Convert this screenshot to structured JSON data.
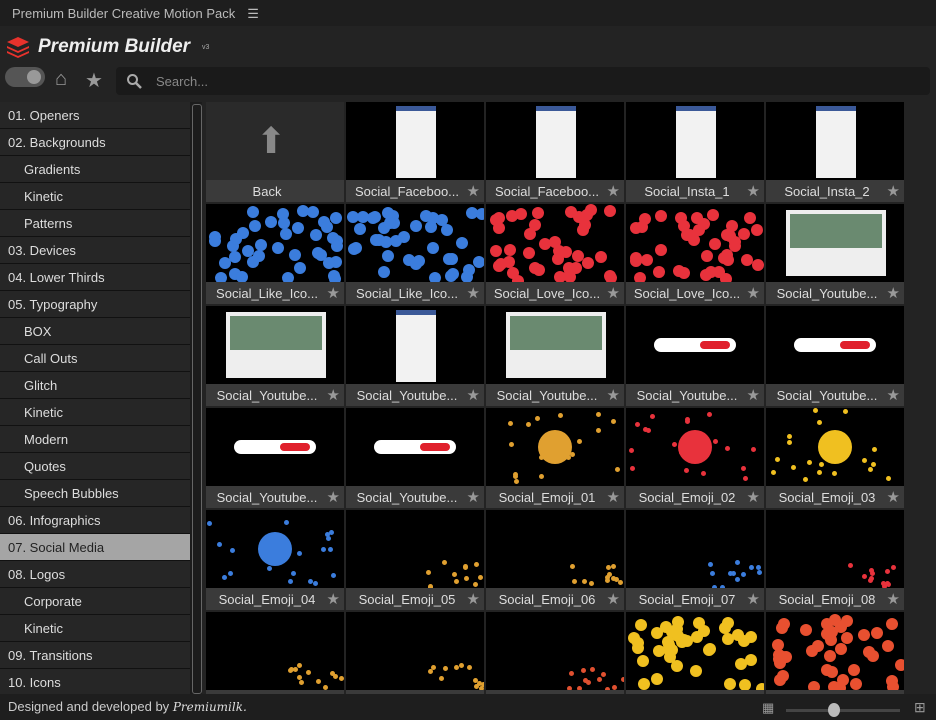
{
  "window": {
    "title": "Premium Builder Creative Motion Pack",
    "menu_icon": "☰"
  },
  "brand": {
    "name": "Premium Builder",
    "version": "v3",
    "color": "#e8322c"
  },
  "search": {
    "placeholder": "Search..."
  },
  "sidebar": [
    {
      "label": "01. Openers",
      "sub": false
    },
    {
      "label": "02. Backgrounds",
      "sub": false
    },
    {
      "label": "Gradients",
      "sub": true
    },
    {
      "label": "Kinetic",
      "sub": true
    },
    {
      "label": "Patterns",
      "sub": true
    },
    {
      "label": "03. Devices",
      "sub": false
    },
    {
      "label": "04. Lower Thirds",
      "sub": false
    },
    {
      "label": "05. Typography",
      "sub": false
    },
    {
      "label": "BOX",
      "sub": true
    },
    {
      "label": "Call Outs",
      "sub": true
    },
    {
      "label": "Glitch",
      "sub": true
    },
    {
      "label": "Kinetic",
      "sub": true
    },
    {
      "label": "Modern",
      "sub": true
    },
    {
      "label": "Quotes",
      "sub": true
    },
    {
      "label": "Speech Bubbles",
      "sub": true
    },
    {
      "label": "06. Infographics",
      "sub": false
    },
    {
      "label": "07. Social Media",
      "sub": false,
      "active": true
    },
    {
      "label": "08. Logos",
      "sub": false
    },
    {
      "label": "Corporate",
      "sub": true
    },
    {
      "label": "Kinetic",
      "sub": true
    },
    {
      "label": "09. Transitions",
      "sub": false
    },
    {
      "label": "10. Icons",
      "sub": false
    }
  ],
  "tiles": [
    {
      "label": "Back",
      "kind": "back"
    },
    {
      "label": "Social_Faceboo...",
      "kind": "phone"
    },
    {
      "label": "Social_Faceboo...",
      "kind": "phone"
    },
    {
      "label": "Social_Insta_1",
      "kind": "phone"
    },
    {
      "label": "Social_Insta_2",
      "kind": "phone"
    },
    {
      "label": "Social_Like_Ico...",
      "kind": "dots",
      "color": "#3b7ddd"
    },
    {
      "label": "Social_Like_Ico...",
      "kind": "dots",
      "color": "#3b7ddd"
    },
    {
      "label": "Social_Love_Ico...",
      "kind": "dots",
      "color": "#e8323c"
    },
    {
      "label": "Social_Love_Ico...",
      "kind": "dots",
      "color": "#e8323c"
    },
    {
      "label": "Social_Youtube...",
      "kind": "screen"
    },
    {
      "label": "Social_Youtube...",
      "kind": "screen"
    },
    {
      "label": "Social_Youtube...",
      "kind": "phone"
    },
    {
      "label": "Social_Youtube...",
      "kind": "screen"
    },
    {
      "label": "Social_Youtube...",
      "kind": "pill"
    },
    {
      "label": "Social_Youtube...",
      "kind": "pill"
    },
    {
      "label": "Social_Youtube...",
      "kind": "pill"
    },
    {
      "label": "Social_Youtube...",
      "kind": "pill"
    },
    {
      "label": "Social_Emoji_01",
      "kind": "sparse",
      "color": "#e0a030"
    },
    {
      "label": "Social_Emoji_02",
      "kind": "sparse",
      "color": "#e8323c"
    },
    {
      "label": "Social_Emoji_03",
      "kind": "sparse",
      "color": "#f0c020"
    },
    {
      "label": "Social_Emoji_04",
      "kind": "sparse",
      "color": "#3b7ddd"
    },
    {
      "label": "Social_Emoji_05",
      "kind": "corner",
      "color": "#e0a030"
    },
    {
      "label": "Social_Emoji_06",
      "kind": "corner",
      "color": "#e0a030"
    },
    {
      "label": "Social_Emoji_07",
      "kind": "corner",
      "color": "#3b7ddd"
    },
    {
      "label": "Social_Emoji_08",
      "kind": "corner",
      "color": "#e8323c"
    },
    {
      "label": "",
      "kind": "corner",
      "color": "#e0a030"
    },
    {
      "label": "",
      "kind": "corner",
      "color": "#e0a030"
    },
    {
      "label": "",
      "kind": "corner",
      "color": "#e05030"
    },
    {
      "label": "",
      "kind": "dots",
      "color": "#f0c020"
    },
    {
      "label": "",
      "kind": "dots",
      "color": "#e85030"
    }
  ],
  "footer": {
    "credit": "Designed and developed by",
    "signature": "Premiumilk."
  }
}
